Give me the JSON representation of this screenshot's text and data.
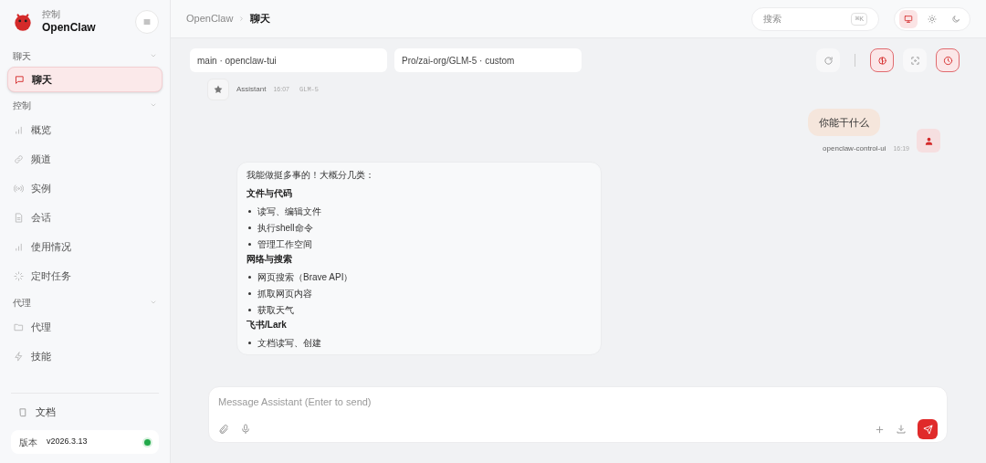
{
  "sidebar": {
    "brand": {
      "subtitle": "控制",
      "title": "OpenClaw"
    },
    "groups": [
      {
        "label": "聊天",
        "expanded": true,
        "items": [
          {
            "label": "聊天",
            "selected": true
          }
        ]
      },
      {
        "label": "控制",
        "expanded": true,
        "items": [
          {
            "label": "概览",
            "selected": false
          },
          {
            "label": "频道",
            "selected": false
          },
          {
            "label": "实例",
            "selected": false
          },
          {
            "label": "会话",
            "selected": false
          },
          {
            "label": "使用情况",
            "selected": false
          },
          {
            "label": "定时任务",
            "selected": false
          }
        ]
      },
      {
        "label": "代理",
        "expanded": true,
        "items": [
          {
            "label": "代理",
            "selected": false
          },
          {
            "label": "技能",
            "selected": false
          }
        ]
      }
    ],
    "docs": "文档",
    "version": {
      "label": "版本",
      "value": "v2026.3.13",
      "online": true
    }
  },
  "breadcrumb": [
    "OpenClaw",
    "聊天"
  ],
  "search": {
    "placeholder": "搜索",
    "shortcut": "⌘K"
  },
  "theme": [
    {
      "selected": true
    },
    {
      "selected": false
    },
    {
      "selected": false
    }
  ],
  "session": {
    "agent": "main · openclaw-tui",
    "model": "Pro/zai-org/GLM-5 · custom"
  },
  "toolbar": [
    {
      "on": false
    },
    {
      "on": true
    },
    {
      "on": false
    },
    {
      "on": true
    }
  ],
  "messages": [
    {
      "kind": "meta",
      "sender": "Assistant",
      "time": "16:07",
      "model": "GLM-5"
    },
    {
      "kind": "user",
      "text": "你能干什么",
      "sender": "openclaw-control-ui",
      "time": "16:19"
    },
    {
      "kind": "assistant",
      "blocks": [
        {
          "kind": "p",
          "text": "我能做挺多事的！大概分几类："
        },
        {
          "kind": "h",
          "text": "文件与代码"
        },
        {
          "kind": "li",
          "text": "读写、编辑文件"
        },
        {
          "kind": "li",
          "text": "执行shell命令"
        },
        {
          "kind": "li",
          "text": "管理工作空间"
        },
        {
          "kind": "h",
          "text": "网络与搜索"
        },
        {
          "kind": "li",
          "text": "网页搜索（Brave API）"
        },
        {
          "kind": "li",
          "text": "抓取网页内容"
        },
        {
          "kind": "li",
          "text": "获取天气"
        },
        {
          "kind": "h",
          "text": "飞书/Lark"
        },
        {
          "kind": "li",
          "text": "文档读写、创建"
        }
      ]
    }
  ],
  "composer": {
    "placeholder": "Message Assistant (Enter to send)"
  }
}
